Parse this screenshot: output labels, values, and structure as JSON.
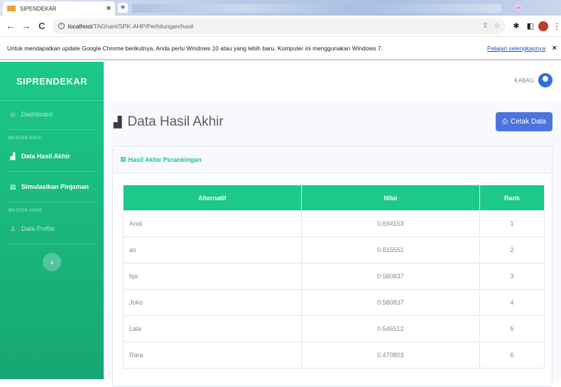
{
  "browser": {
    "tab_title": "SIPENDEKAR",
    "tab_close": "×",
    "new_tab": "+",
    "url_host": "localhost",
    "url_path": "/TAGhani/SPK-AHP/Perhitungan/hasil",
    "back": "←",
    "forward": "→",
    "reload": "C",
    "info_icon": "i",
    "share_icon": "⇪",
    "star_icon": "☆",
    "puzzle_icon": "✱",
    "sidebar_icon": "◧",
    "menu_icon": "⋮",
    "profile_dropdown": "⌄"
  },
  "infobar": {
    "message": "Untuk mendapatkan update Google Chrome berikutnya, Anda perlu Windows 10 atau yang lebih baru. Komputer ini menggunakan Windows 7.",
    "learn_more": "Pelajari selengkapnya",
    "close": "×"
  },
  "sidebar": {
    "brand": "SIPRENDEKAR",
    "dashboard": "Dashboard",
    "heading_master_data": "MASTER DATA",
    "data_hasil_akhir": "Data Hasil Akhir",
    "simulasi": "Simulasikan Pinjaman",
    "heading_master_user": "MASTER USER",
    "data_profile": "Data Profile",
    "toggle": "‹"
  },
  "topbar": {
    "user_name": "KABAG"
  },
  "page": {
    "title": "Data Hasil Akhir",
    "print_button": "Cetak Data"
  },
  "card": {
    "header": "Hasil Akhir Perankingan"
  },
  "table": {
    "headers": [
      "Alternatif",
      "Nilai",
      "Rank"
    ],
    "rows": [
      {
        "alternatif": "Andi",
        "nilai": "0.694153",
        "rank": "1"
      },
      {
        "alternatif": "as",
        "nilai": "0.615551",
        "rank": "2"
      },
      {
        "alternatif": "bpr",
        "nilai": "0.580837",
        "rank": "3"
      },
      {
        "alternatif": "Joko",
        "nilai": "0.580837",
        "rank": "4"
      },
      {
        "alternatif": "Lala",
        "nilai": "0.546512",
        "rank": "5"
      },
      {
        "alternatif": "Rara",
        "nilai": "0.470803",
        "rank": "6"
      }
    ]
  },
  "colors": {
    "primary_green": "#1cc88a",
    "primary_blue": "#4e73df"
  },
  "icons": {
    "dashboard": "tachometer-icon",
    "data_hasil_akhir": "chart-area-icon",
    "simulasi": "calculator-icon",
    "data_profile": "user-icon",
    "print": "print-icon",
    "table_header": "table-icon",
    "user_avatar": "user-circle-icon"
  }
}
